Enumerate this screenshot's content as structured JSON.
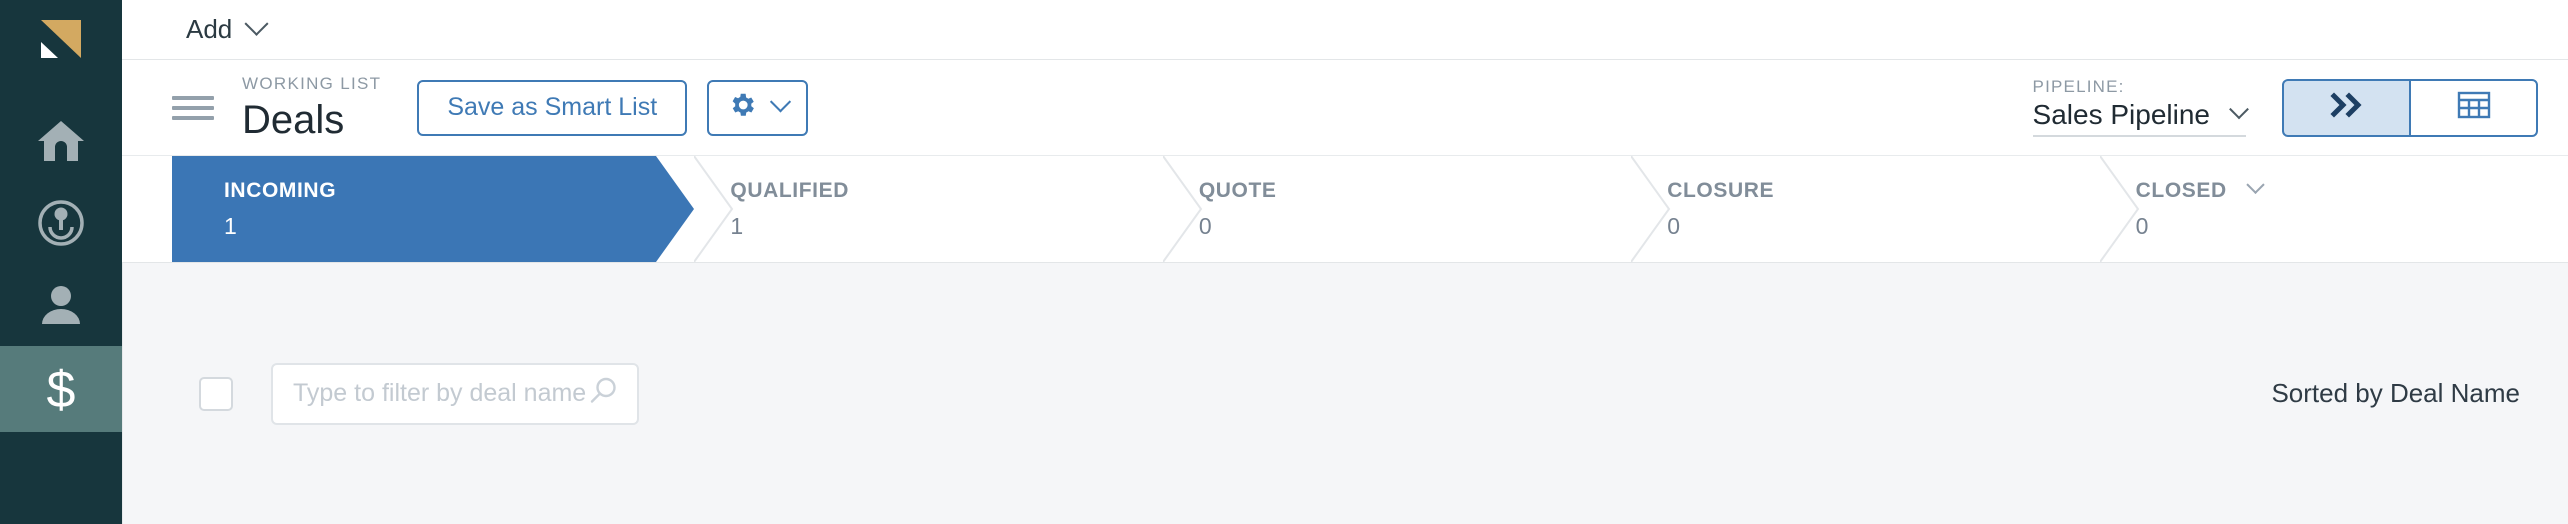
{
  "sidebar": {
    "logo_name": "logo-triangles",
    "items": [
      {
        "id": "home",
        "icon": "home-icon",
        "label": "Home",
        "active": false
      },
      {
        "id": "activity",
        "icon": "broadcast-icon",
        "label": "Activity",
        "active": false
      },
      {
        "id": "contacts",
        "icon": "person-icon",
        "label": "Contacts",
        "active": false
      },
      {
        "id": "deals",
        "icon": "dollar-icon",
        "label": "Deals",
        "active": true
      }
    ]
  },
  "topbar": {
    "add_label": "Add",
    "add_chevron": "chevron-down-icon"
  },
  "header": {
    "menu_icon": "hamburger-icon",
    "eyebrow": "WORKING LIST",
    "title": "Deals",
    "save_smart_list_label": "Save as Smart List",
    "settings_icon": "gear-icon",
    "settings_chevron": "chevron-down-icon",
    "pipeline_label": "PIPELINE:",
    "pipeline_value": "Sales Pipeline",
    "pipeline_chevron": "chevron-down-icon",
    "view_toggle": [
      {
        "id": "pipeline-view",
        "icon": "double-chevron-right-icon",
        "active": true
      },
      {
        "id": "table-view",
        "icon": "table-grid-icon",
        "active": false
      }
    ]
  },
  "stages": [
    {
      "name": "INCOMING",
      "count": "1",
      "active": true,
      "has_chevron": false
    },
    {
      "name": "QUALIFIED",
      "count": "1",
      "active": false,
      "has_chevron": false
    },
    {
      "name": "QUOTE",
      "count": "0",
      "active": false,
      "has_chevron": false
    },
    {
      "name": "CLOSURE",
      "count": "0",
      "active": false,
      "has_chevron": false
    },
    {
      "name": "CLOSED",
      "count": "0",
      "active": false,
      "has_chevron": true
    }
  ],
  "filterbar": {
    "select_all_checkbox": "unchecked",
    "filter_placeholder": "Type to filter by deal name",
    "filter_value": "",
    "search_icon": "search-icon",
    "sorted_by": "Sorted by Deal Name"
  },
  "colors": {
    "sidebar_bg": "#17363d",
    "sidebar_active_bg": "#567b7b",
    "logo_gold": "#d3a961",
    "accent_blue": "#3f7ab5",
    "stage_active_bg": "#3b76b5",
    "toggle_active_bg": "#d3e2f1",
    "filterbar_bg": "#f5f6f8",
    "muted_text": "#818d99",
    "title_text": "#202b33"
  }
}
